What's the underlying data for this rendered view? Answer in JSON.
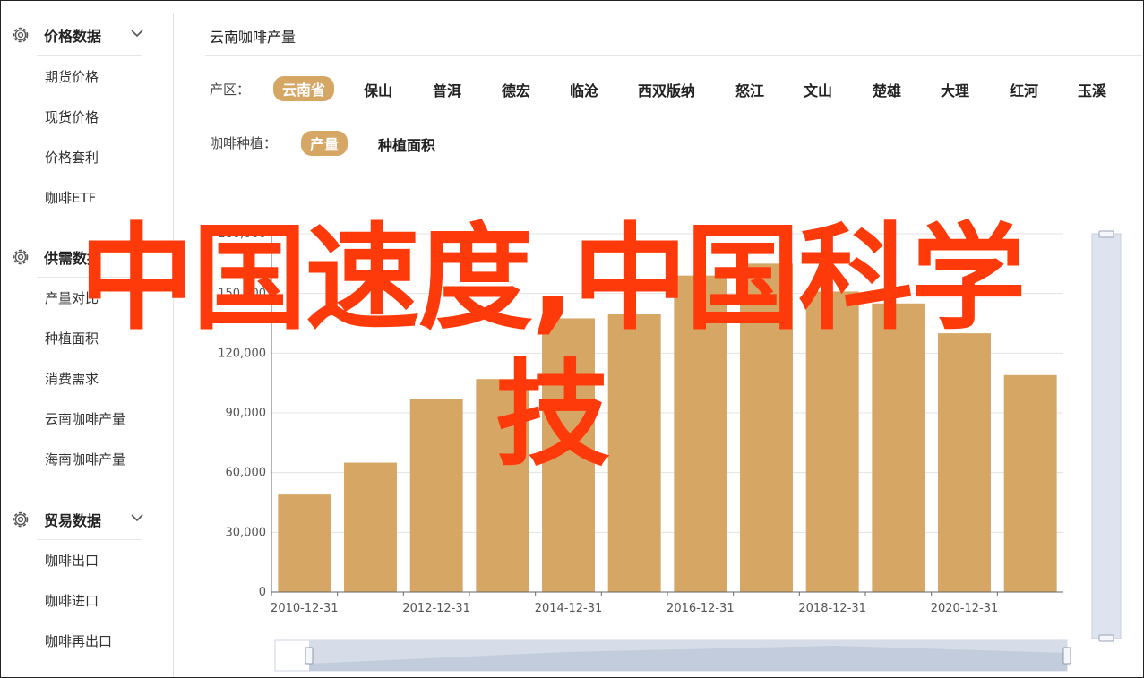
{
  "sidebar": {
    "sections": [
      {
        "title": "价格数据",
        "items": [
          "期货价格",
          "现货价格",
          "价格套利",
          "咖啡ETF"
        ]
      },
      {
        "title": "供需数据",
        "items": [
          "产量对比",
          "种植面积",
          "消费需求",
          "云南咖啡产量",
          "海南咖啡产量"
        ]
      },
      {
        "title": "贸易数据",
        "items": [
          "咖啡出口",
          "咖啡进口",
          "咖啡再出口"
        ]
      }
    ]
  },
  "main": {
    "title": "云南咖啡产量",
    "region_label": "产区：",
    "regions": [
      "云南省",
      "保山",
      "普洱",
      "德宏",
      "临沧",
      "西双版纳",
      "怒江",
      "文山",
      "楚雄",
      "大理",
      "红河",
      "玉溪"
    ],
    "active_region": "云南省",
    "plant_label": "咖啡种植：",
    "plant_options": [
      "产量",
      "种植面积"
    ],
    "active_plant": "产量"
  },
  "overlay": {
    "text": "中国速度,中国科学技"
  },
  "colors": {
    "accent": "#d6a664",
    "bar": "#d6a664",
    "overlay": "#ff3a0a"
  },
  "chart_data": {
    "type": "bar",
    "categories": [
      "2010-12-31",
      "2011-12-31",
      "2012-12-31",
      "2013-12-31",
      "2014-12-31",
      "2015-12-31",
      "2016-12-31",
      "2017-12-31",
      "2018-12-31",
      "2019-12-31",
      "2020-12-31",
      "2021-12-31"
    ],
    "x_tick_labels": [
      "2010-12-31",
      "2012-12-31",
      "2014-12-31",
      "2016-12-31",
      "2018-12-31",
      "2020-12-31"
    ],
    "values": [
      49000,
      65000,
      97000,
      107000,
      137500,
      139500,
      159000,
      165000,
      151000,
      145000,
      130000,
      109000
    ],
    "y_ticks": [
      0,
      30000,
      60000,
      90000,
      120000,
      150000,
      180000
    ],
    "y_tick_labels": [
      "0",
      "30,000",
      "60,000",
      "90,000",
      "120,000",
      "150,000",
      "180,000"
    ],
    "ylim": [
      0,
      180000
    ],
    "grid": true
  }
}
